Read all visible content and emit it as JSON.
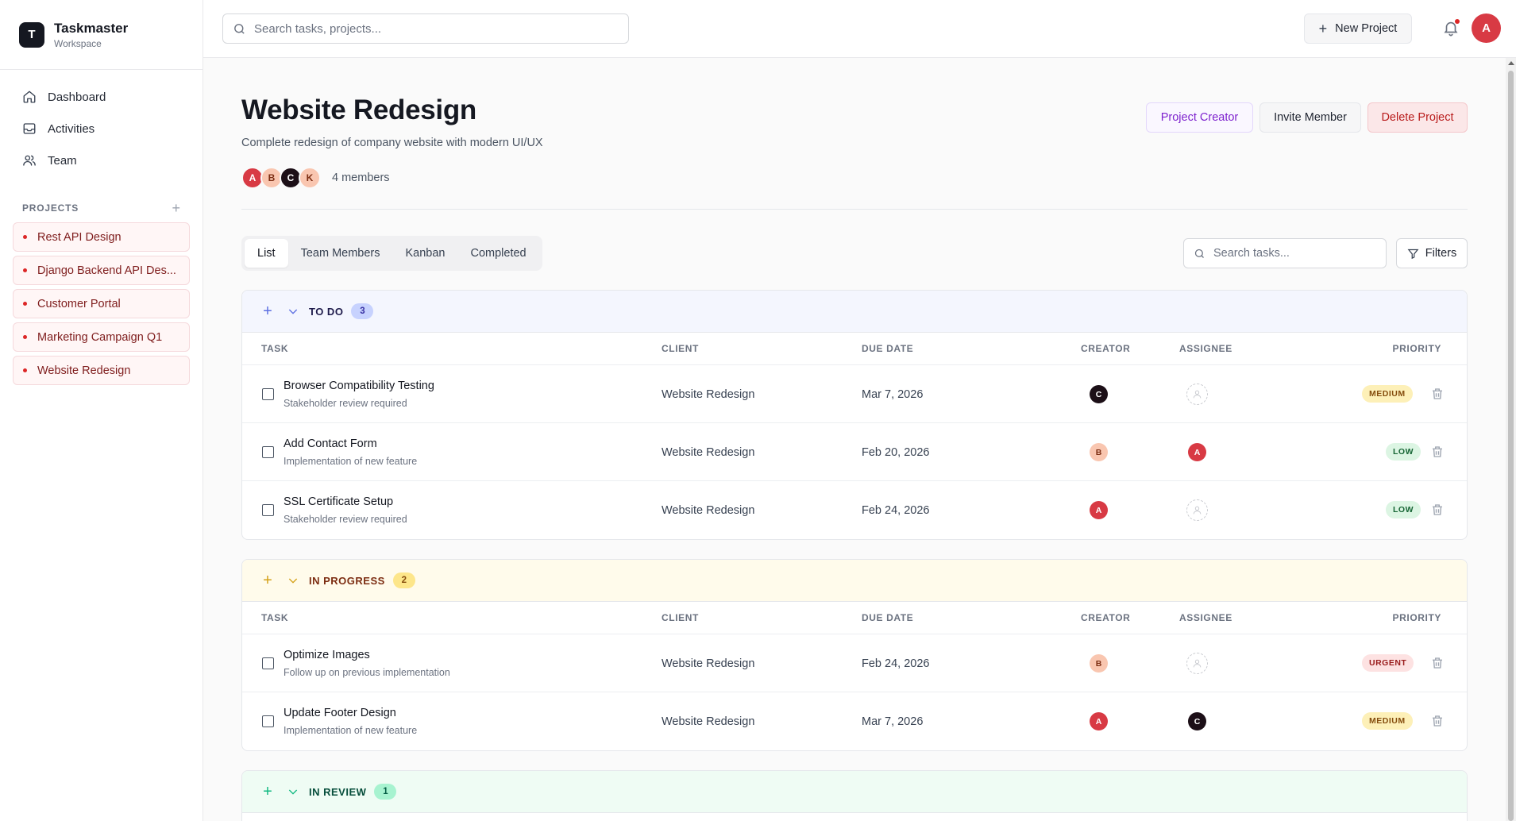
{
  "brand": {
    "initial": "T",
    "name": "Taskmaster",
    "sub": "Workspace"
  },
  "nav": [
    {
      "label": "Dashboard",
      "icon": "home-icon"
    },
    {
      "label": "Activities",
      "icon": "inbox-icon"
    },
    {
      "label": "Team",
      "icon": "users-icon"
    }
  ],
  "projects": {
    "title": "PROJECTS",
    "add": "+",
    "items": [
      "Rest API Design",
      "Django Backend API Des...",
      "Customer Portal",
      "Marketing Campaign Q1",
      "Website Redesign"
    ]
  },
  "topbar": {
    "search_placeholder": "Search tasks, projects...",
    "new_project": "New Project",
    "user_initial": "A"
  },
  "page": {
    "title": "Website Redesign",
    "description": "Complete redesign of company website with modern UI/UX",
    "members": [
      {
        "initial": "A",
        "bg": "#d83a44",
        "fg": "#ffffff"
      },
      {
        "initial": "B",
        "bg": "#f9c6b0",
        "fg": "#7c2d12"
      },
      {
        "initial": "C",
        "bg": "#1c0f17",
        "fg": "#ffffff"
      },
      {
        "initial": "K",
        "bg": "#f9c6b0",
        "fg": "#7c2d12"
      }
    ],
    "members_count": "4 members",
    "buttons": {
      "creator": "Project Creator",
      "invite": "Invite Member",
      "delete": "Delete Project"
    }
  },
  "tabs": [
    "List",
    "Team Members",
    "Kanban",
    "Completed"
  ],
  "task_search_placeholder": "Search tasks...",
  "filters_label": "Filters",
  "columns": {
    "task": "TASK",
    "client": "CLIENT",
    "due": "DUE DATE",
    "creator": "CREATOR",
    "assignee": "ASSIGNEE",
    "priority": "PRIORITY"
  },
  "groups": {
    "todo": {
      "title": "TO DO",
      "count": "3",
      "rows": [
        {
          "name": "Browser Compatibility Testing",
          "sub": "Stakeholder review required",
          "client": "Website Redesign",
          "due": "Mar 7, 2026",
          "creator": "C",
          "assignee": "",
          "priority": "MEDIUM"
        },
        {
          "name": "Add Contact Form",
          "sub": "Implementation of new feature",
          "client": "Website Redesign",
          "due": "Feb 20, 2026",
          "creator": "B",
          "assignee": "A",
          "priority": "LOW"
        },
        {
          "name": "SSL Certificate Setup",
          "sub": "Stakeholder review required",
          "client": "Website Redesign",
          "due": "Feb 24, 2026",
          "creator": "A",
          "assignee": "",
          "priority": "LOW"
        }
      ]
    },
    "inprogress": {
      "title": "IN PROGRESS",
      "count": "2",
      "rows": [
        {
          "name": "Optimize Images",
          "sub": "Follow up on previous implementation",
          "client": "Website Redesign",
          "due": "Feb 24, 2026",
          "creator": "B",
          "assignee": "",
          "priority": "URGENT"
        },
        {
          "name": "Update Footer Design",
          "sub": "Implementation of new feature",
          "client": "Website Redesign",
          "due": "Mar 7, 2026",
          "creator": "A",
          "assignee": "C",
          "priority": "MEDIUM"
        }
      ]
    },
    "inreview": {
      "title": "IN REVIEW",
      "count": "1"
    }
  },
  "colors": {
    "avatar_A": "#d83a44",
    "avatar_B": "#f9c6b0",
    "avatar_C": "#1c0f17",
    "todo_accent": "#5b6ee1",
    "inprogress_accent": "#b7791f",
    "inreview_accent": "#059669",
    "priority_medium": "#fdf0b8",
    "priority_low": "#dcf5e3",
    "priority_urgent": "#fde2e2"
  }
}
